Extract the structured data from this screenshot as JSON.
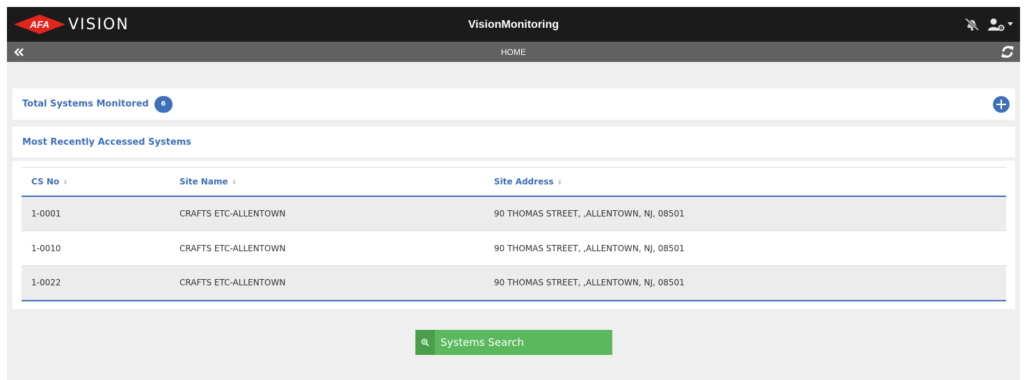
{
  "brand": {
    "logo_text": "AFA",
    "wordmark": "VISION"
  },
  "header": {
    "title": "VisionMonitoring"
  },
  "subheader": {
    "breadcrumb": "HOME"
  },
  "summary": {
    "label": "Total Systems Monitored",
    "count": "6"
  },
  "recent": {
    "title": "Most Recently Accessed Systems"
  },
  "table": {
    "columns": [
      "CS No",
      "Site Name",
      "Site Address"
    ],
    "rows": [
      {
        "cs_no": "1-0001",
        "site_name": "CRAFTS ETC-ALLENTOWN",
        "site_address": "90 THOMAS STREET, ,ALLENTOWN, NJ, 08501"
      },
      {
        "cs_no": "1-0010",
        "site_name": "CRAFTS ETC-ALLENTOWN",
        "site_address": "90 THOMAS STREET, ,ALLENTOWN, NJ, 08501"
      },
      {
        "cs_no": "1-0022",
        "site_name": "CRAFTS ETC-ALLENTOWN",
        "site_address": "90 THOMAS STREET, ,ALLENTOWN, NJ, 08501"
      }
    ]
  },
  "actions": {
    "search_label": "Systems Search"
  },
  "icons": {
    "mute": "bell-slash-icon",
    "user": "user-settings-icon",
    "back": "double-chevron-left-icon",
    "refresh": "refresh-icon",
    "add": "plus-circle-icon",
    "search": "zoom-icon"
  },
  "colors": {
    "accent": "#3f6fb8",
    "topbar": "#1b1b1b",
    "subbar": "#616161",
    "success": "#5cb85c",
    "brand_red": "#e0261d"
  }
}
